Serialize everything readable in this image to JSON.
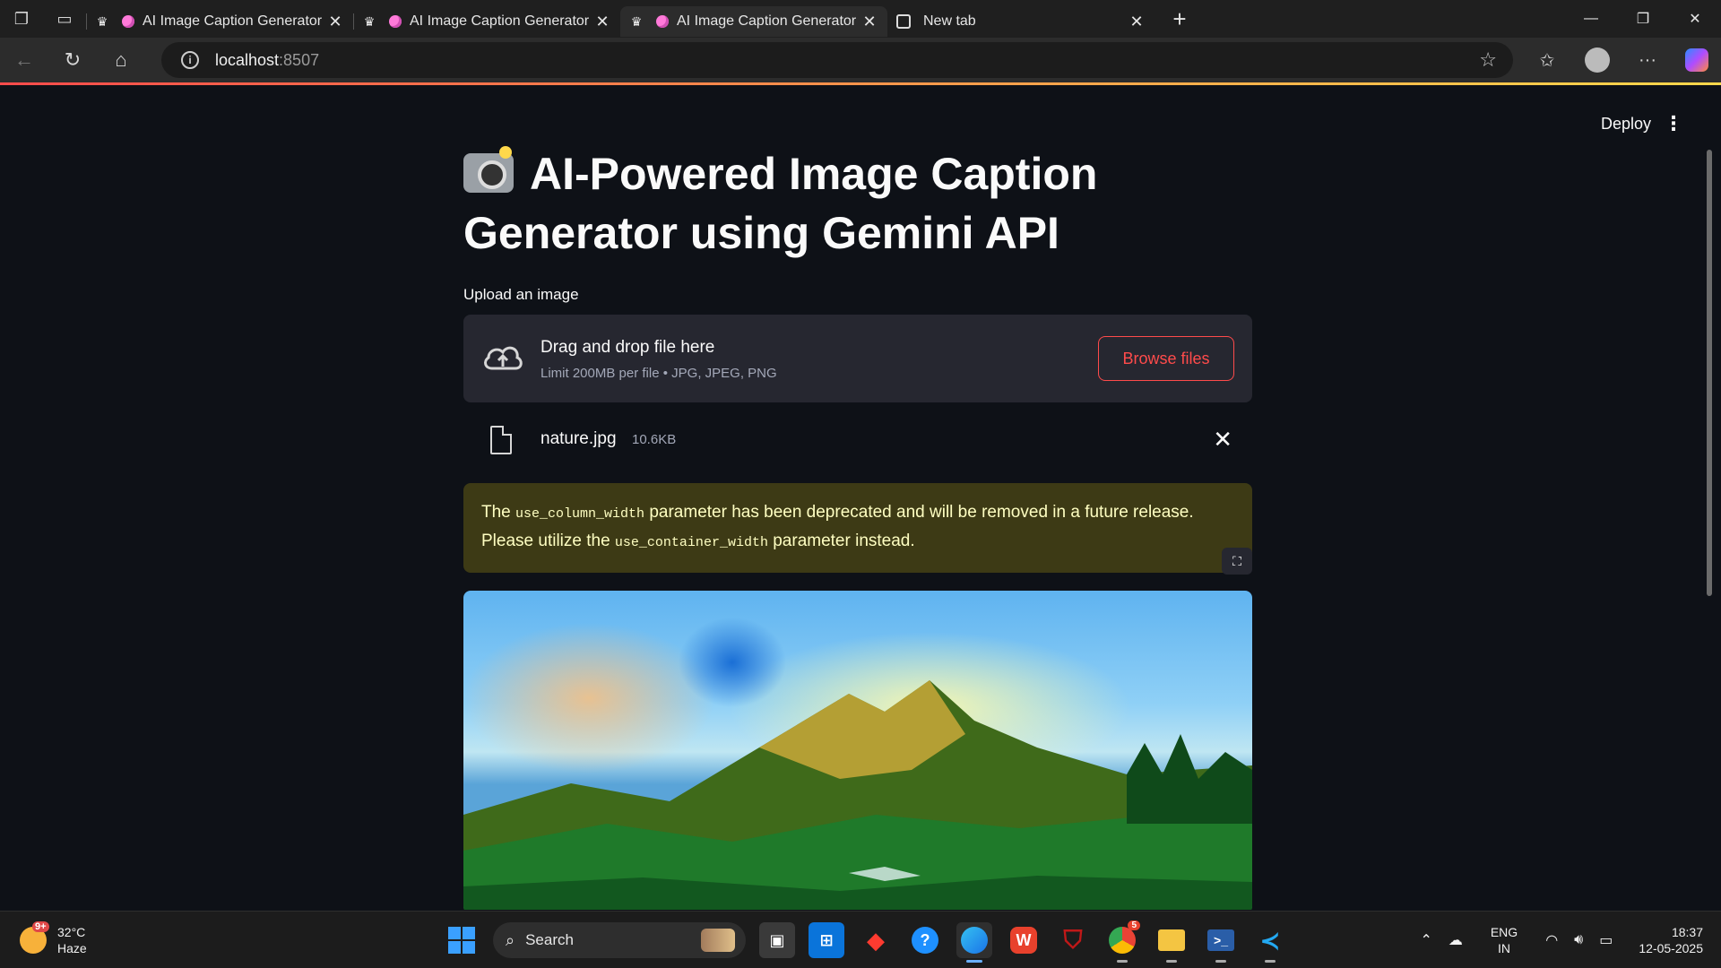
{
  "browser": {
    "tabs": [
      {
        "title": "AI Image Caption Generator",
        "active": false
      },
      {
        "title": "AI Image Caption Generator",
        "active": false
      },
      {
        "title": "AI Image Caption Generator",
        "active": true
      },
      {
        "title": "New tab",
        "active": false
      }
    ],
    "url_host": "localhost",
    "url_port": ":8507"
  },
  "app": {
    "deploy_label": "Deploy",
    "title": "AI-Powered Image Caption Generator using Gemini API",
    "uploader": {
      "label": "Upload an image",
      "drop_title": "Drag and drop file here",
      "drop_hint": "Limit 200MB per file • JPG, JPEG, PNG",
      "browse_label": "Browse files"
    },
    "file": {
      "name": "nature.jpg",
      "size": "10.6KB"
    },
    "warning": {
      "part1": "The ",
      "code1": "use_column_width",
      "part2": " parameter has been deprecated and will be removed in a future release. Please utilize the ",
      "code2": "use_container_width",
      "part3": " parameter instead."
    }
  },
  "taskbar": {
    "weather_temp": "32°C",
    "weather_desc": "Haze",
    "weather_badge": "9+",
    "search_label": "Search",
    "lang_top": "ENG",
    "lang_bottom": "IN",
    "time": "18:37",
    "date": "12-05-2025",
    "chrome_badge": "5"
  },
  "colors": {
    "accent": "#ff4b4b",
    "warning_bg": "#3d3a15",
    "warning_text": "#ffffc2",
    "app_bg": "#0e1117"
  }
}
